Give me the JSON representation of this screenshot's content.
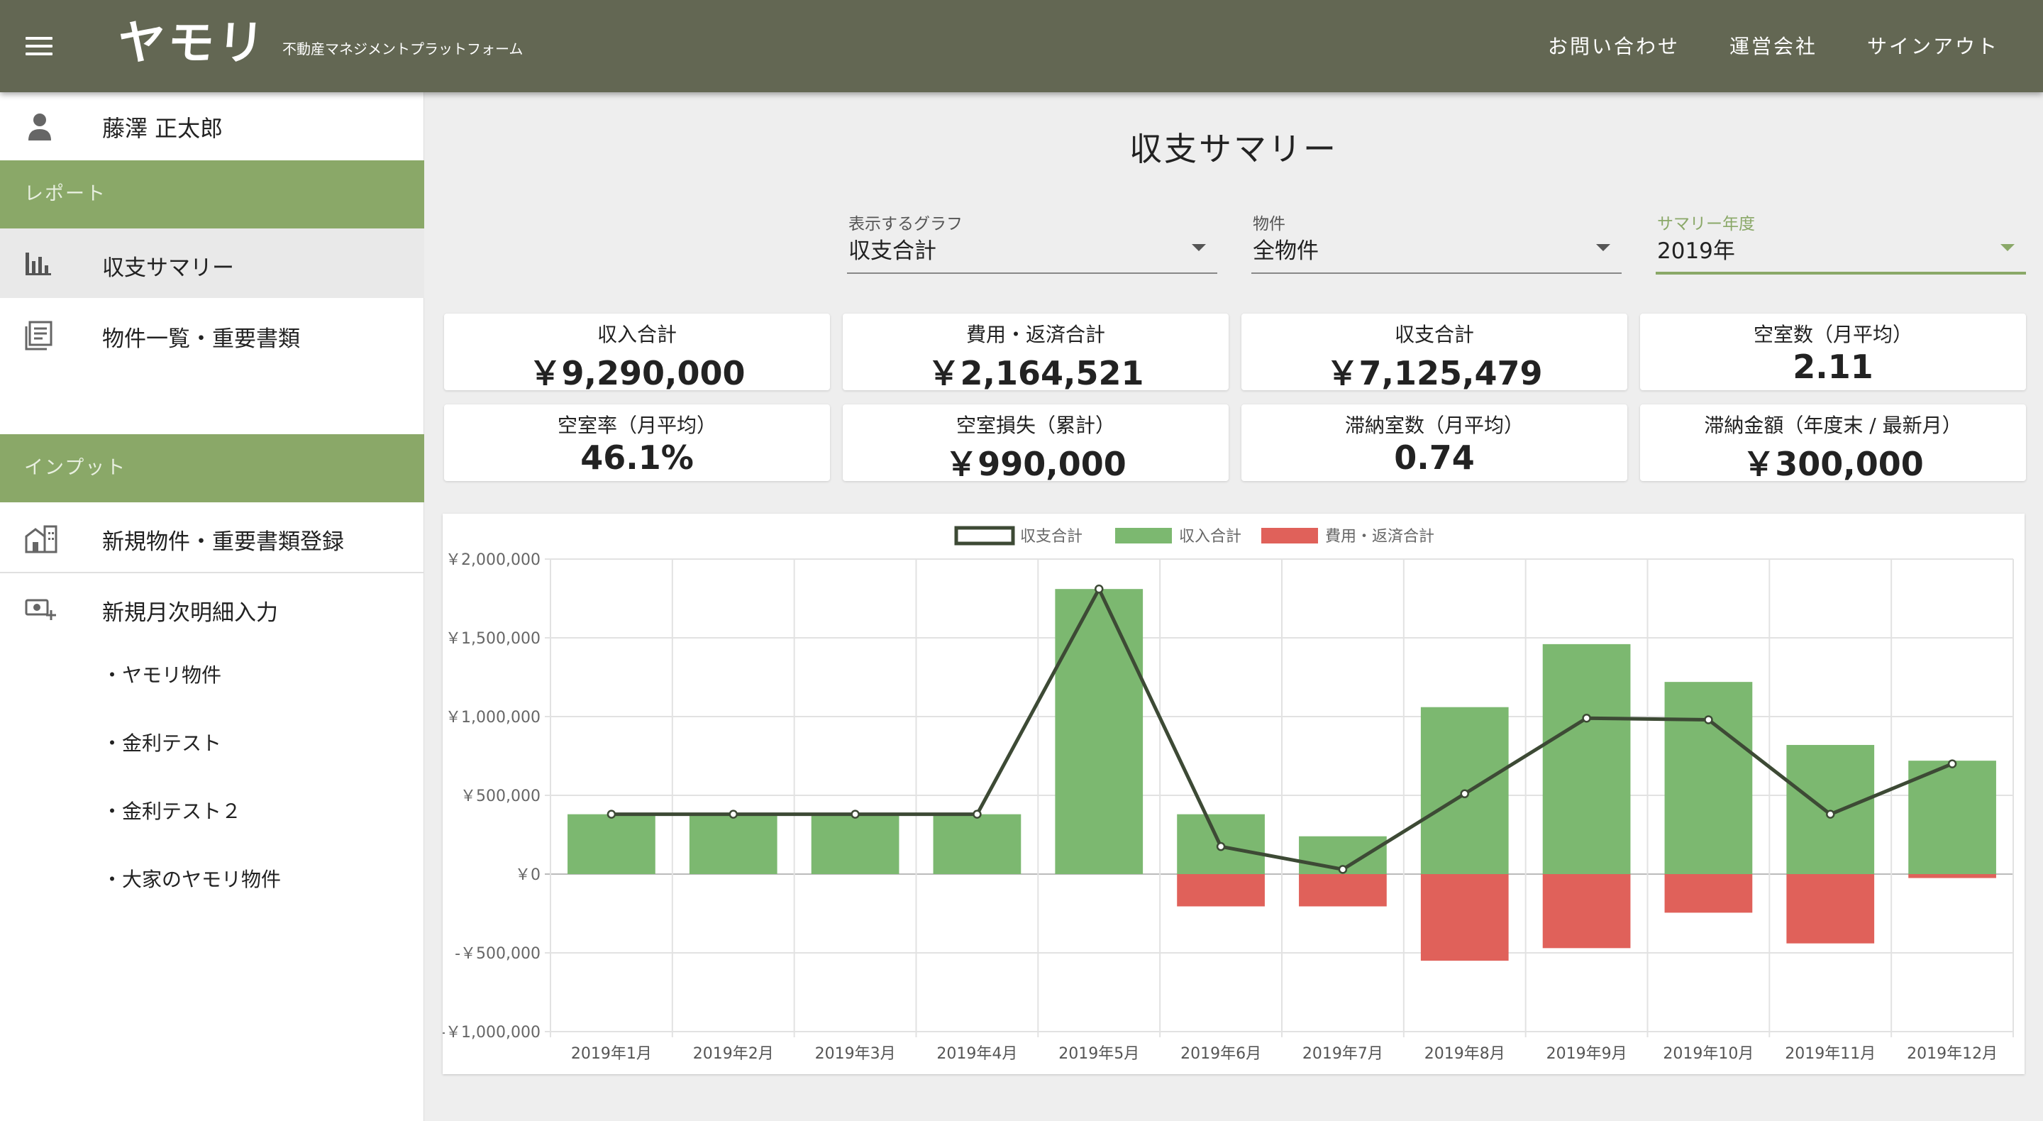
{
  "header": {
    "logo": "ヤモリ",
    "subtitle": "不動産マネジメントプラットフォーム",
    "nav": [
      "お問い合わせ",
      "運営会社",
      "サインアウト"
    ]
  },
  "sidebar": {
    "user_name": "藤澤 正太郎",
    "section_report": "レポート",
    "report_items": [
      "収支サマリー",
      "物件一覧・重要書類"
    ],
    "section_input": "インプット",
    "input_items": [
      "新規物件・重要書類登録",
      "新規月次明細入力"
    ],
    "sub_items": [
      "・ヤモリ物件",
      "・金利テスト",
      "・金利テスト２",
      "・大家のヤモリ物件"
    ]
  },
  "main": {
    "title": "収支サマリー",
    "selects": [
      {
        "label": "表示するグラフ",
        "value": "収支合計"
      },
      {
        "label": "物件",
        "value": "全物件"
      },
      {
        "label": "サマリー年度",
        "value": "2019年"
      }
    ],
    "cards": [
      {
        "label": "収入合計",
        "value": "￥9,290,000"
      },
      {
        "label": "費用・返済合計",
        "value": "￥2,164,521"
      },
      {
        "label": "収支合計",
        "value": "￥7,125,479"
      },
      {
        "label": "空室数（月平均）",
        "value": "2.11"
      },
      {
        "label": "空室率（月平均）",
        "value": "46.1%"
      },
      {
        "label": "空室損失（累計）",
        "value": "￥990,000"
      },
      {
        "label": "滞納室数（月平均）",
        "value": "0.74"
      },
      {
        "label": "滞納金額（年度末 / 最新月）",
        "value": "￥300,000"
      }
    ]
  },
  "colors": {
    "header": "#636753",
    "accent": "#8aa868",
    "income": "#7cb870",
    "expense": "#e0615a",
    "balance_line": "#3d4a35"
  },
  "chart_data": {
    "type": "bar",
    "categories": [
      "2019年1月",
      "2019年2月",
      "2019年3月",
      "2019年4月",
      "2019年5月",
      "2019年6月",
      "2019年7月",
      "2019年8月",
      "2019年9月",
      "2019年10月",
      "2019年11月",
      "2019年12月"
    ],
    "series": [
      {
        "name": "収支合計",
        "type": "line",
        "color": "#3d4a35",
        "values": [
          380000,
          380000,
          380000,
          380000,
          1810000,
          175000,
          30000,
          510000,
          990000,
          980000,
          380000,
          700000
        ]
      },
      {
        "name": "収入合計",
        "type": "bar",
        "color": "#7cb870",
        "values": [
          380000,
          380000,
          380000,
          380000,
          1810000,
          380000,
          240000,
          1060000,
          1460000,
          1220000,
          820000,
          720000
        ]
      },
      {
        "name": "費用・返済合計",
        "type": "bar",
        "color": "#e0615a",
        "values": [
          0,
          0,
          0,
          0,
          0,
          -205000,
          -205000,
          -550000,
          -470000,
          -245000,
          -440000,
          -25000
        ]
      }
    ],
    "y_ticks": [
      "￥2,000,000",
      "￥1,500,000",
      "￥1,000,000",
      "￥500,000",
      "￥0",
      "-￥500,000",
      "-￥1,000,000"
    ],
    "ylim": [
      -1000000,
      2000000
    ],
    "grid": true,
    "legend": "top-center"
  }
}
